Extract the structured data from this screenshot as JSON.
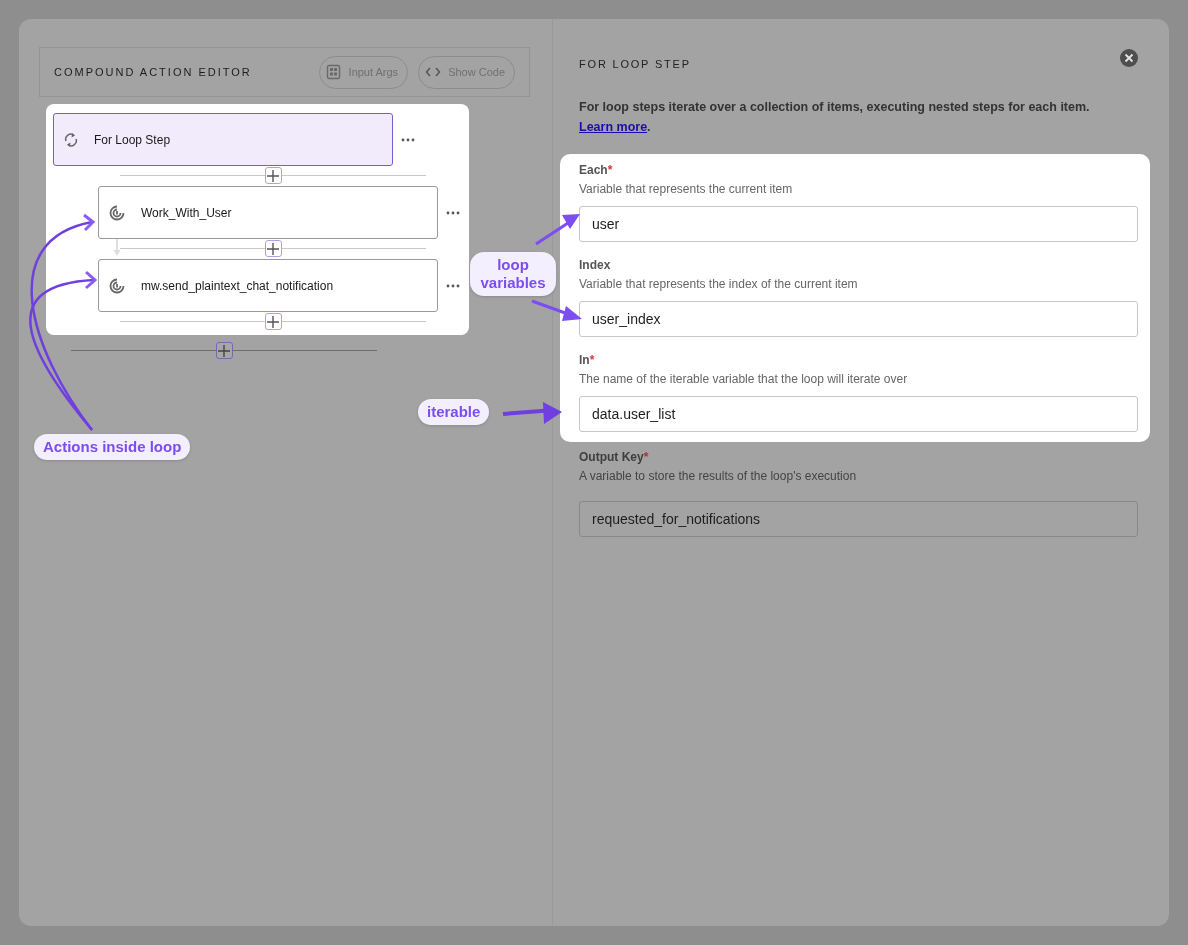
{
  "editor": {
    "title": "COMPOUND ACTION EDITOR",
    "buttons": [
      {
        "label": "Input Args",
        "kind": "args"
      },
      {
        "label": "Show Code",
        "kind": "code"
      }
    ]
  },
  "flow": {
    "steps": [
      {
        "label": "For Loop Step",
        "kind": "loop",
        "selected": true,
        "children": [
          {
            "label": "Work_With_User",
            "kind": "action",
            "selected": false
          },
          {
            "label": "mw.send_plaintext_chat_notification",
            "kind": "action",
            "selected": false
          }
        ]
      }
    ]
  },
  "panel": {
    "title": "FOR LOOP STEP",
    "description": "For loop steps iterate over a collection of items, executing nested steps for each item.",
    "link": "Learn more",
    "link_suffix": ".",
    "required_mark": "*",
    "spotlight_fields": [
      {
        "label": "Each",
        "required": true,
        "hint": "Variable that represents the current item",
        "value": "user"
      },
      {
        "label": "Index",
        "required": false,
        "hint": "Variable that represents the index of the current item",
        "value": "user_index"
      },
      {
        "label": "In",
        "required": true,
        "hint": "The name of the iterable variable that the loop will iterate over",
        "value": "data.user_list"
      }
    ],
    "fields": [
      {
        "label": "Output Key",
        "required": true,
        "hint": "A variable to store the results of the loop's execution",
        "value": "requested_for_notifications"
      }
    ]
  },
  "annotations": [
    {
      "text": "loop variables",
      "kind": "variables"
    },
    {
      "text": "iterable",
      "kind": "iterable"
    },
    {
      "text": "Actions inside loop",
      "kind": "actions"
    }
  ]
}
